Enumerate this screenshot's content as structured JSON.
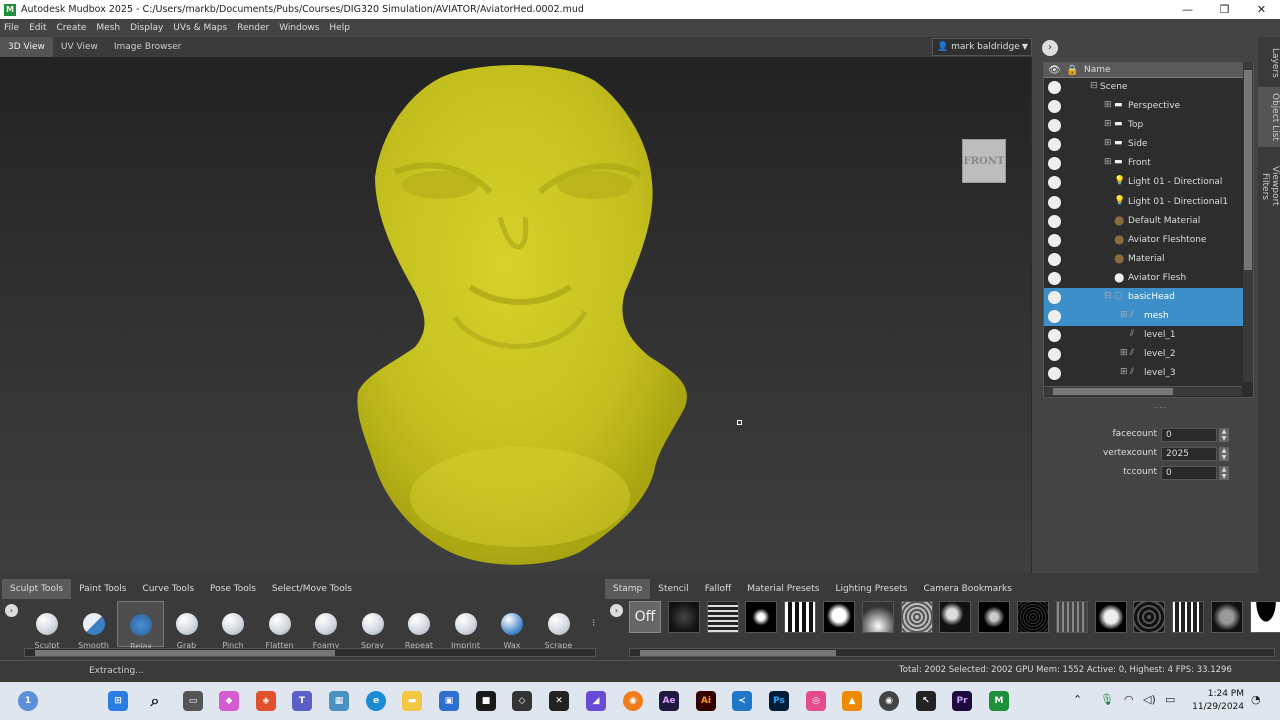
{
  "window": {
    "app_icon_letter": "M",
    "title": "Autodesk Mudbox 2025 - C:/Users/markb/Documents/Pubs/Courses/DIG320 Simulation/AVIATOR/AviatorHed.0002.mud",
    "minimize": "—",
    "maximize": "❐",
    "close": "✕"
  },
  "menu": [
    "File",
    "Edit",
    "Create",
    "Mesh",
    "Display",
    "UVs & Maps",
    "Render",
    "Windows",
    "Help"
  ],
  "view_tabs": [
    "3D View",
    "UV View",
    "Image Browser"
  ],
  "user": {
    "name": "mark baldridge"
  },
  "viewcube": {
    "label": "FRONT"
  },
  "model": {
    "color": "#c9c520"
  },
  "side_tabs": [
    "Layers",
    "Object List",
    "Viewport Filters"
  ],
  "object_list": {
    "header_name": "Name",
    "rows": [
      {
        "prefix": "⊟",
        "label": "Scene",
        "icon": "none"
      },
      {
        "prefix": "⊞",
        "label": "Perspective",
        "icon": "camera"
      },
      {
        "prefix": "⊞",
        "label": "Top",
        "icon": "camera"
      },
      {
        "prefix": "⊞",
        "label": "Side",
        "icon": "camera"
      },
      {
        "prefix": "⊞",
        "label": "Front",
        "icon": "camera"
      },
      {
        "prefix": "",
        "label": "Light 01 - Directional",
        "icon": "light"
      },
      {
        "prefix": "",
        "label": "Light 01 - Directional1",
        "icon": "light"
      },
      {
        "prefix": "",
        "label": "Default Material",
        "icon": "material"
      },
      {
        "prefix": "",
        "label": "Aviator Fleshtone",
        "icon": "material"
      },
      {
        "prefix": "",
        "label": "Material",
        "icon": "material"
      },
      {
        "prefix": "",
        "label": "Aviator Flesh",
        "icon": "white-material"
      },
      {
        "prefix": "⊟",
        "label": "basicHead",
        "icon": "mesh",
        "selected": true
      },
      {
        "prefix": "⊞",
        "label": "mesh",
        "icon": "mesh-level",
        "selected": true
      },
      {
        "prefix": "",
        "label": "level_1",
        "icon": "mesh-level"
      },
      {
        "prefix": "⊞",
        "label": "level_2",
        "icon": "mesh-level"
      },
      {
        "prefix": "⊞",
        "label": "level_3",
        "icon": "mesh-level"
      }
    ]
  },
  "properties": [
    {
      "label": "facecount",
      "value": "0"
    },
    {
      "label": "vertexcount",
      "value": "2025"
    },
    {
      "label": "tccount",
      "value": "0"
    }
  ],
  "sculpt_tabs": [
    "Sculpt Tools",
    "Paint Tools",
    "Curve Tools",
    "Pose Tools",
    "Select/Move Tools"
  ],
  "sculpt_tools": [
    "Sculpt",
    "Smooth",
    "Relax",
    "Grab",
    "Pinch",
    "Flatten",
    "Foamy",
    "Spray",
    "Repeat",
    "Imprint",
    "Wax",
    "Scrape"
  ],
  "stamp_tabs": [
    "Stamp",
    "Stencil",
    "Falloff",
    "Material Presets",
    "Lighting Presets",
    "Camera Bookmarks"
  ],
  "stamp_off_label": "Off",
  "status": {
    "left": "Extracting...",
    "right": "Total: 2002  Selected: 2002  GPU Mem: 1552  Active: 0, Highest: 4  FPS: 33.1296"
  },
  "taskbar": {
    "time": "1:24 PM",
    "date": "11/29/2024",
    "weather_badge": "1",
    "app_letters": [
      "Ae",
      "Ai",
      "Ps",
      "Pr",
      "M"
    ]
  }
}
